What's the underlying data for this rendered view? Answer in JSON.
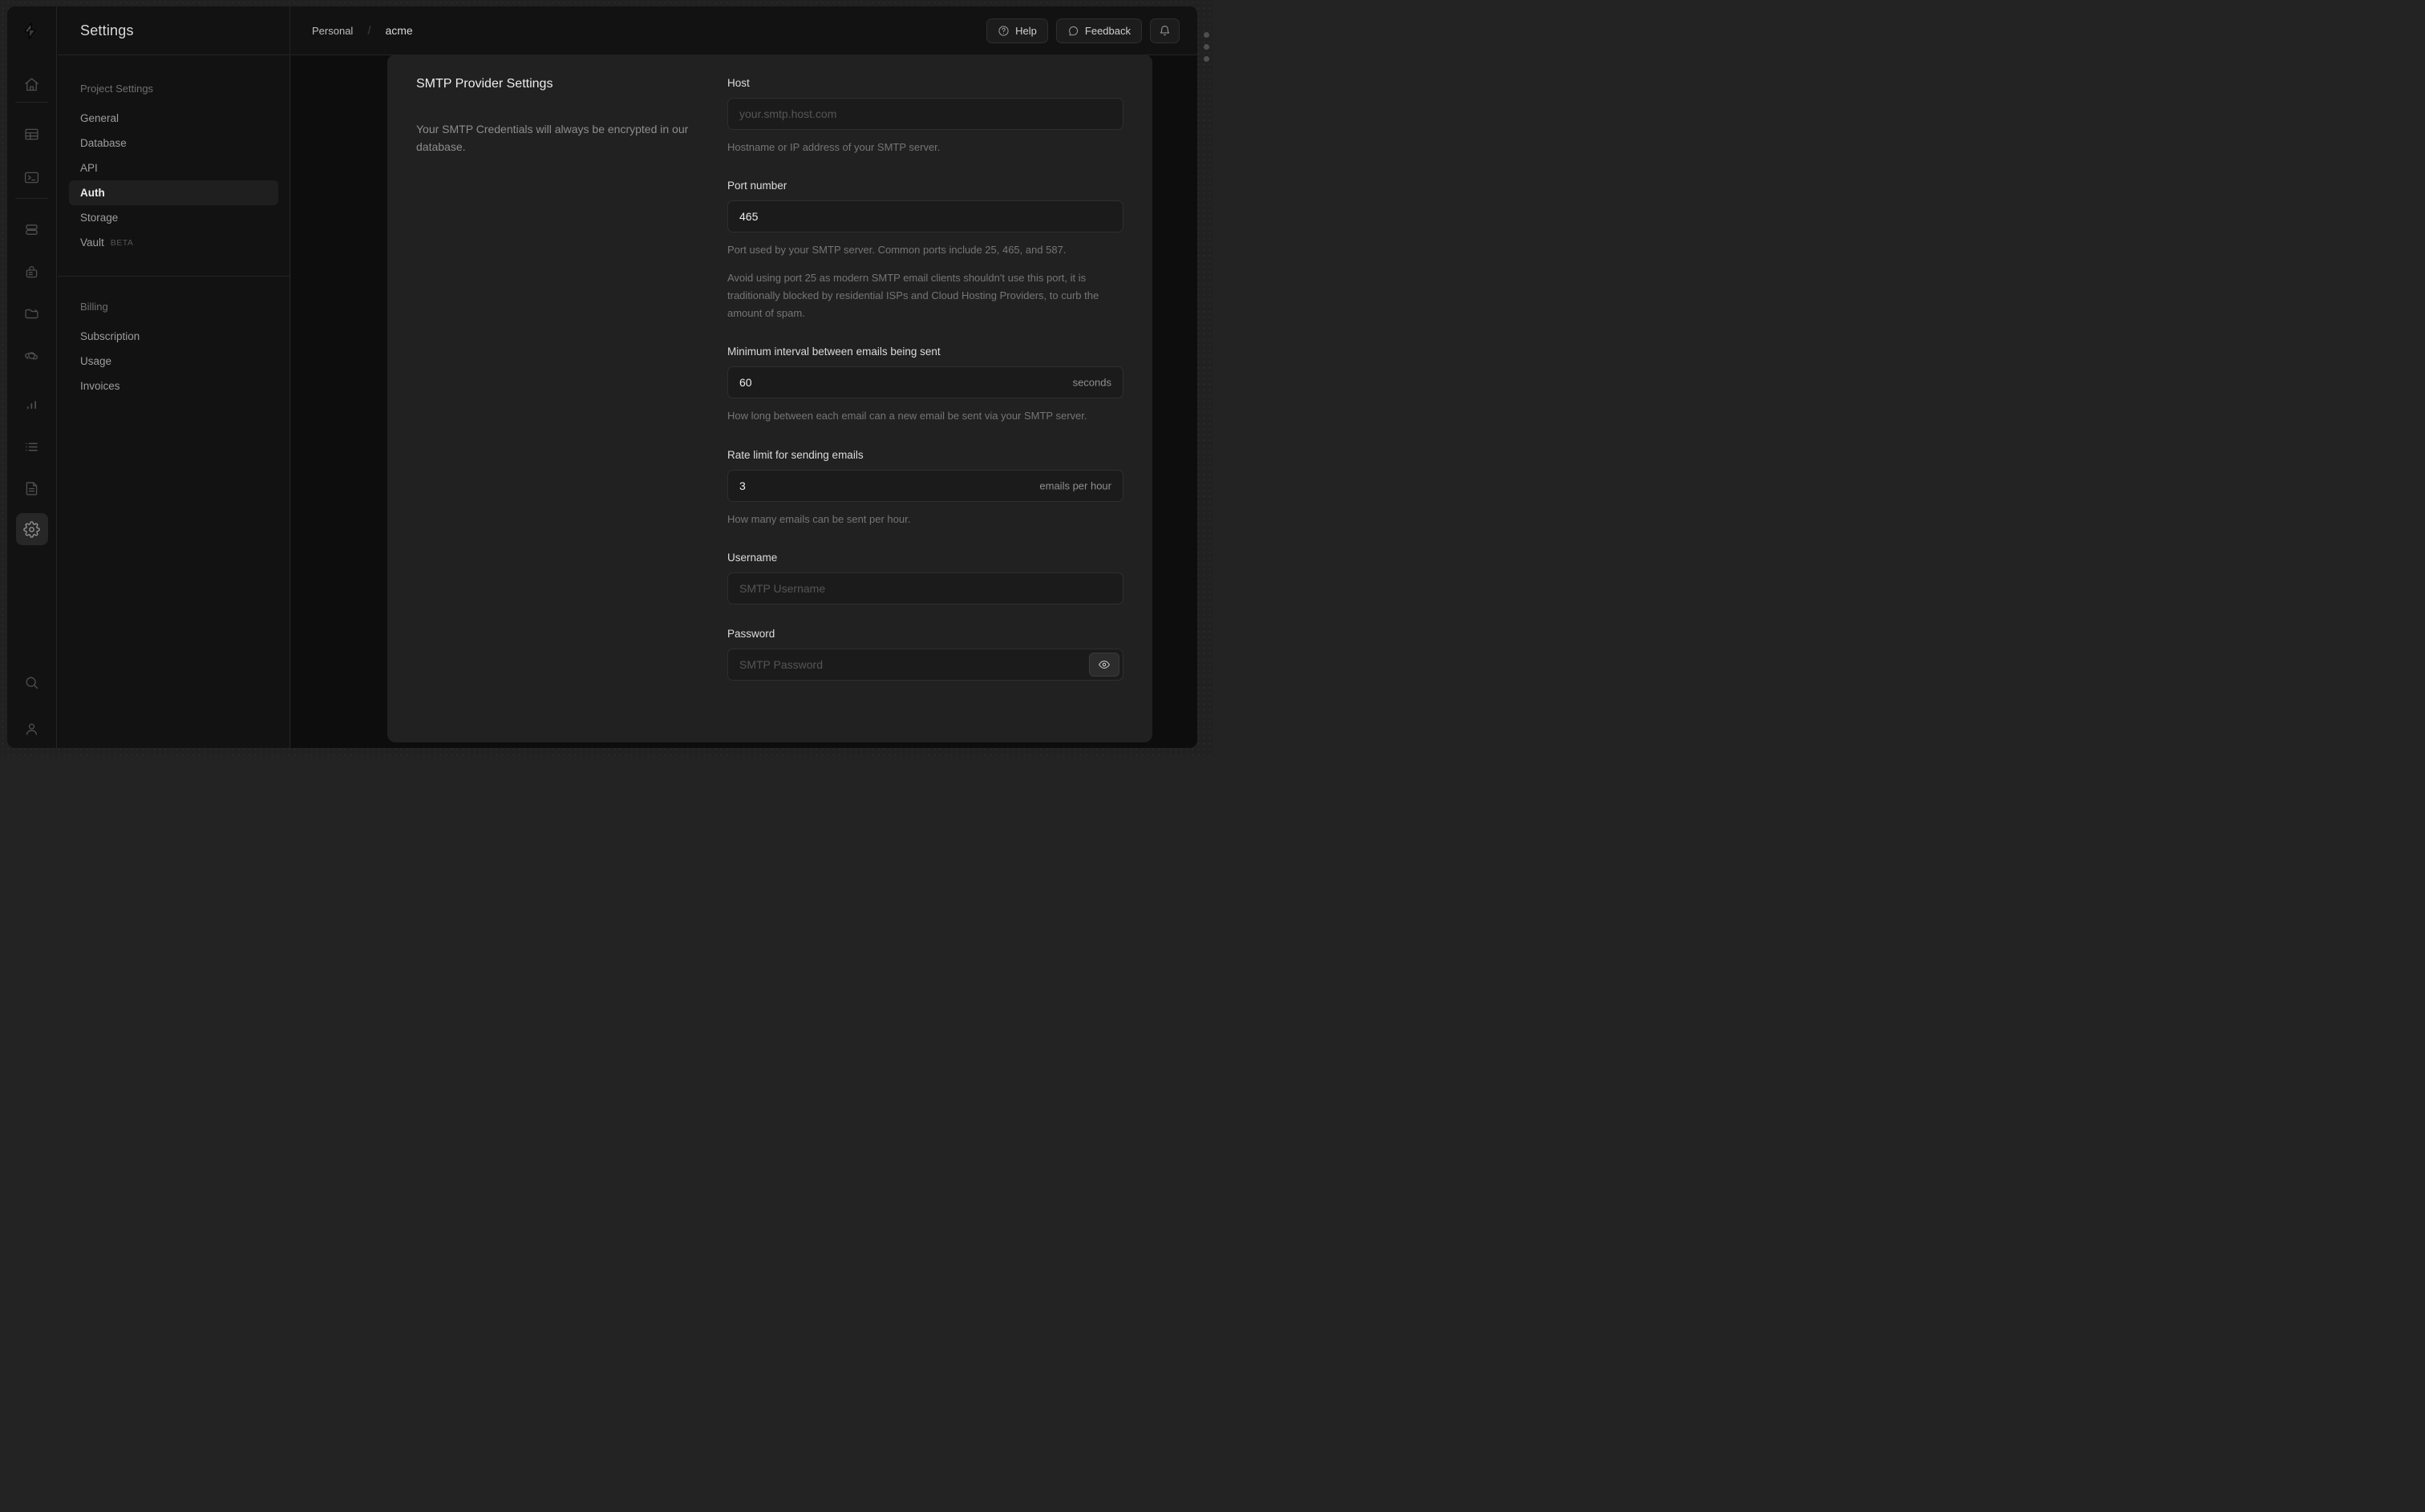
{
  "colors": {
    "app_bg": "#121212",
    "card_bg": "#212121",
    "input_bg": "#1b1b1b",
    "border": "#2e2e2e",
    "text_primary": "#ececec",
    "text_muted": "#757575"
  },
  "rail": {
    "logo": "supabase-logo",
    "icons": [
      "home-icon",
      "table-icon",
      "terminal-icon",
      "database-icon",
      "auth-lock-icon",
      "storage-folder-icon",
      "functions-orbit-icon",
      "reports-chart-icon",
      "logs-list-icon",
      "docs-file-icon",
      "gear-icon",
      "search-icon",
      "user-icon"
    ],
    "active_icon": "gear-icon"
  },
  "sidebar": {
    "title": "Settings",
    "project": {
      "title": "Project Settings",
      "items": [
        {
          "label": "General",
          "selected": false
        },
        {
          "label": "Database",
          "selected": false
        },
        {
          "label": "API",
          "selected": false
        },
        {
          "label": "Auth",
          "selected": true
        },
        {
          "label": "Storage",
          "selected": false
        },
        {
          "label": "Vault",
          "selected": false,
          "badge": "BETA"
        }
      ]
    },
    "billing": {
      "title": "Billing",
      "items": [
        {
          "label": "Subscription"
        },
        {
          "label": "Usage"
        },
        {
          "label": "Invoices"
        }
      ]
    }
  },
  "header": {
    "breadcrumb": {
      "org": "Personal",
      "separator": "/",
      "project": "acme"
    },
    "actions": {
      "help_label": "Help",
      "feedback_label": "Feedback",
      "bell_icon": "bell-icon"
    }
  },
  "panel": {
    "title": "SMTP Provider Settings",
    "description": "Your SMTP Credentials will always be encrypted in our database.",
    "fields": [
      {
        "label": "Host",
        "placeholder": "your.smtp.host.com",
        "helper": [
          "Hostname or IP address of your SMTP server."
        ]
      },
      {
        "label": "Port number",
        "value": "465",
        "helper": [
          "Port used by your SMTP server. Common ports include 25, 465, and 587.",
          "Avoid using port 25 as modern SMTP email clients shouldn't use this port, it is traditionally blocked by residential ISPs and Cloud Hosting Providers, to curb the amount of spam."
        ]
      },
      {
        "label": "Minimum interval between emails being sent",
        "value": "60",
        "suffix": "seconds",
        "helper": [
          "How long between each email can a new email be sent via your SMTP server."
        ]
      },
      {
        "label": "Rate limit for sending emails",
        "value": "3",
        "suffix": "emails per hour",
        "helper": [
          "How many emails can be sent per hour."
        ]
      },
      {
        "label": "Username",
        "placeholder": "SMTP Username"
      },
      {
        "label": "Password",
        "placeholder": "SMTP Password",
        "toggle_icon": "eye-icon"
      }
    ]
  }
}
